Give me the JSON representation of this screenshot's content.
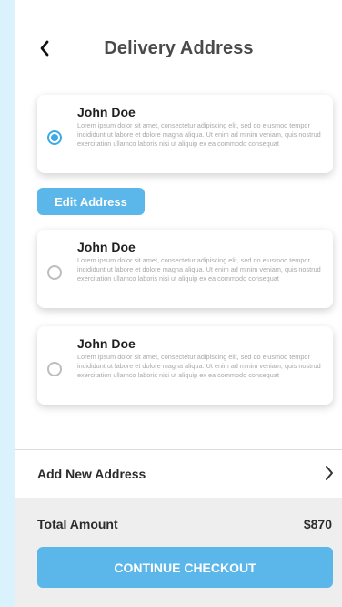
{
  "header": {
    "title": "Delivery Address",
    "back_icon": "chevron-left-icon"
  },
  "addresses": [
    {
      "name": "John Doe",
      "text": "Lorem ipsum dolor sit amet, consectetur adipiscing elit, sed do eiusmod tempor incididunt ut labore et dolore magna aliqua. Ut enim ad minim veniam, quis nostrud exercitation ullamco laboris nisi ut aliquip ex ea commodo consequat",
      "selected": true
    },
    {
      "name": "John Doe",
      "text": "Lorem ipsum dolor sit amet, consectetur adipiscing elit, sed do eiusmod tempor incididunt ut labore et dolore magna aliqua. Ut enim ad minim veniam, quis nostrud exercitation ullamco laboris nisi ut aliquip ex ea commodo consequat",
      "selected": false
    },
    {
      "name": "John Doe",
      "text": "Lorem ipsum dolor sit amet, consectetur adipiscing elit, sed do eiusmod tempor incididunt ut labore et dolore magna aliqua. Ut enim ad minim veniam, quis nostrud exercitation ullamco laboris nisi ut aliquip ex ea commodo consequat",
      "selected": false
    }
  ],
  "edit_button": {
    "label": "Edit Address"
  },
  "add_address": {
    "label": "Add New Address",
    "icon": "chevron-right-icon"
  },
  "total": {
    "label": "Total Amount",
    "value": "$870"
  },
  "checkout_button": {
    "label": "CONTINUE CHECKOUT"
  },
  "colors": {
    "accent": "#5bb7e9",
    "radio_selected": "#3ea9e3",
    "page_background": "#d9f2fb",
    "footer_background": "#eeeeee"
  }
}
